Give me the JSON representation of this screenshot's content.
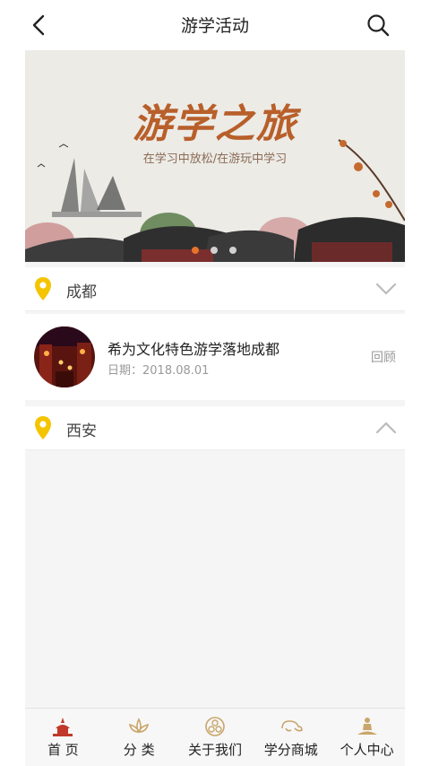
{
  "header": {
    "title": "游学活动"
  },
  "banner": {
    "title": "游学之旅",
    "subtitle": "在学习中放松/在游玩中学习",
    "slides": 3,
    "active_slide": 1
  },
  "sections": [
    {
      "city": "成都",
      "expanded": false,
      "items": [
        {
          "title": "希为文化特色游学落地成都",
          "date": "日期：2018.08.01",
          "action": "回顾"
        }
      ]
    },
    {
      "city": "西安",
      "expanded": true,
      "items": []
    }
  ],
  "tabbar": [
    {
      "label": "首 页",
      "icon": "home-pagoda-icon"
    },
    {
      "label": "分 类",
      "icon": "lotus-icon"
    },
    {
      "label": "关于我们",
      "icon": "emblem-icon"
    },
    {
      "label": "学分商城",
      "icon": "cloud-scroll-icon"
    },
    {
      "label": "个人中心",
      "icon": "meditating-person-icon"
    }
  ],
  "colors": {
    "accent": "#e8732a",
    "pin": "#f5c400",
    "tab_icon": "#c9a66b",
    "home_icon": "#c0392b"
  }
}
